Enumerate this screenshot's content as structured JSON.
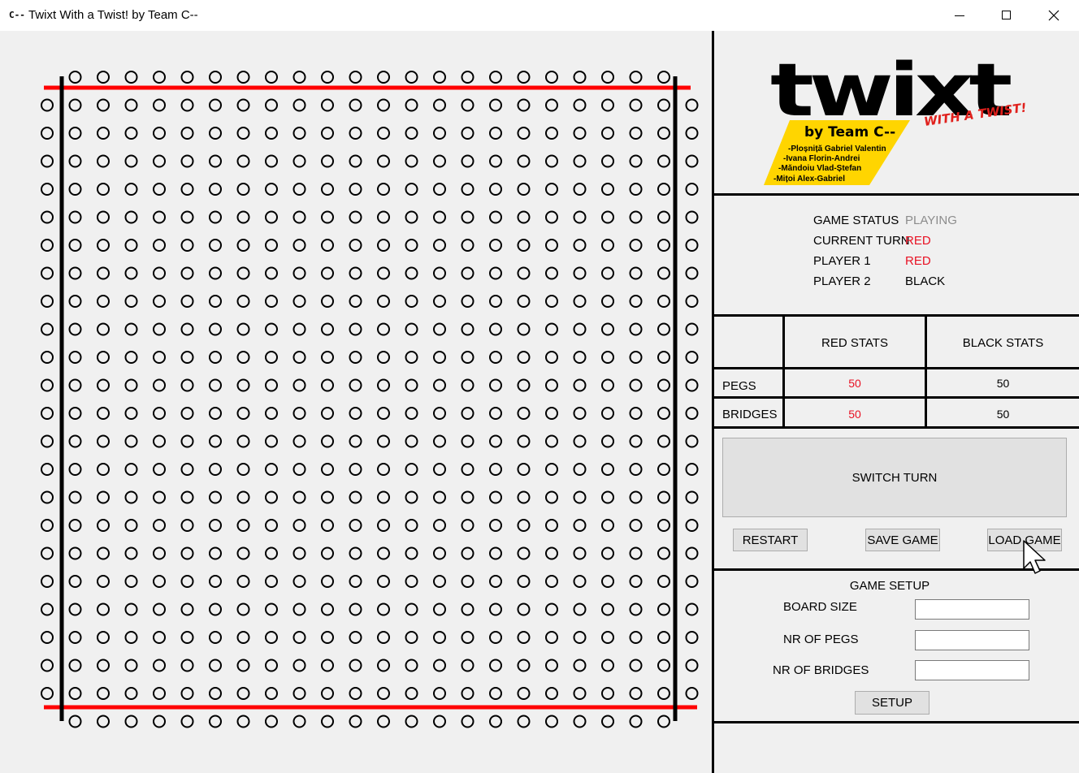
{
  "window": {
    "app_icon": "C--",
    "title": "Twixt With a Twist! by Team C--"
  },
  "board": {
    "size": 24,
    "peg_color": "#000000",
    "red_border_color": "#ff0000",
    "black_border_color": "#000000"
  },
  "logo": {
    "title": "twixt",
    "tagline": "WITH A TWIST!",
    "team": "by Team C--",
    "members": [
      "-Ploșniță Gabriel Valentin",
      "-Ivana Florin-Andrei",
      "-Măndoiu Vlad-Ștefan",
      "-Mițoi Alex-Gabriel"
    ],
    "banner_color": "#ffd500",
    "tagline_color": "#e0201c"
  },
  "status": {
    "game_status_label": "GAME STATUS",
    "game_status_value": "PLAYING",
    "current_turn_label": "CURRENT TURN",
    "current_turn_value": "RED",
    "player1_label": "PLAYER 1",
    "player1_value": "RED",
    "player2_label": "PLAYER 2",
    "player2_value": "BLACK",
    "playing_color": "#8c8c8c",
    "red_color": "#e81123"
  },
  "stats": {
    "red_header": "RED STATS",
    "black_header": "BLACK STATS",
    "rows": [
      {
        "label": "PEGS",
        "red": "50",
        "black": "50"
      },
      {
        "label": "BRIDGES",
        "red": "50",
        "black": "50"
      }
    ]
  },
  "controls": {
    "switch_turn": "SWITCH TURN",
    "restart": "RESTART",
    "save_game": "SAVE GAME",
    "load_game": "LOAD GAME"
  },
  "setup": {
    "title": "GAME SETUP",
    "board_size_label": "BOARD SIZE",
    "board_size_value": "",
    "pegs_label": "NR OF PEGS",
    "pegs_value": "",
    "bridges_label": "NR OF BRIDGES",
    "bridges_value": "",
    "setup_button": "SETUP"
  }
}
